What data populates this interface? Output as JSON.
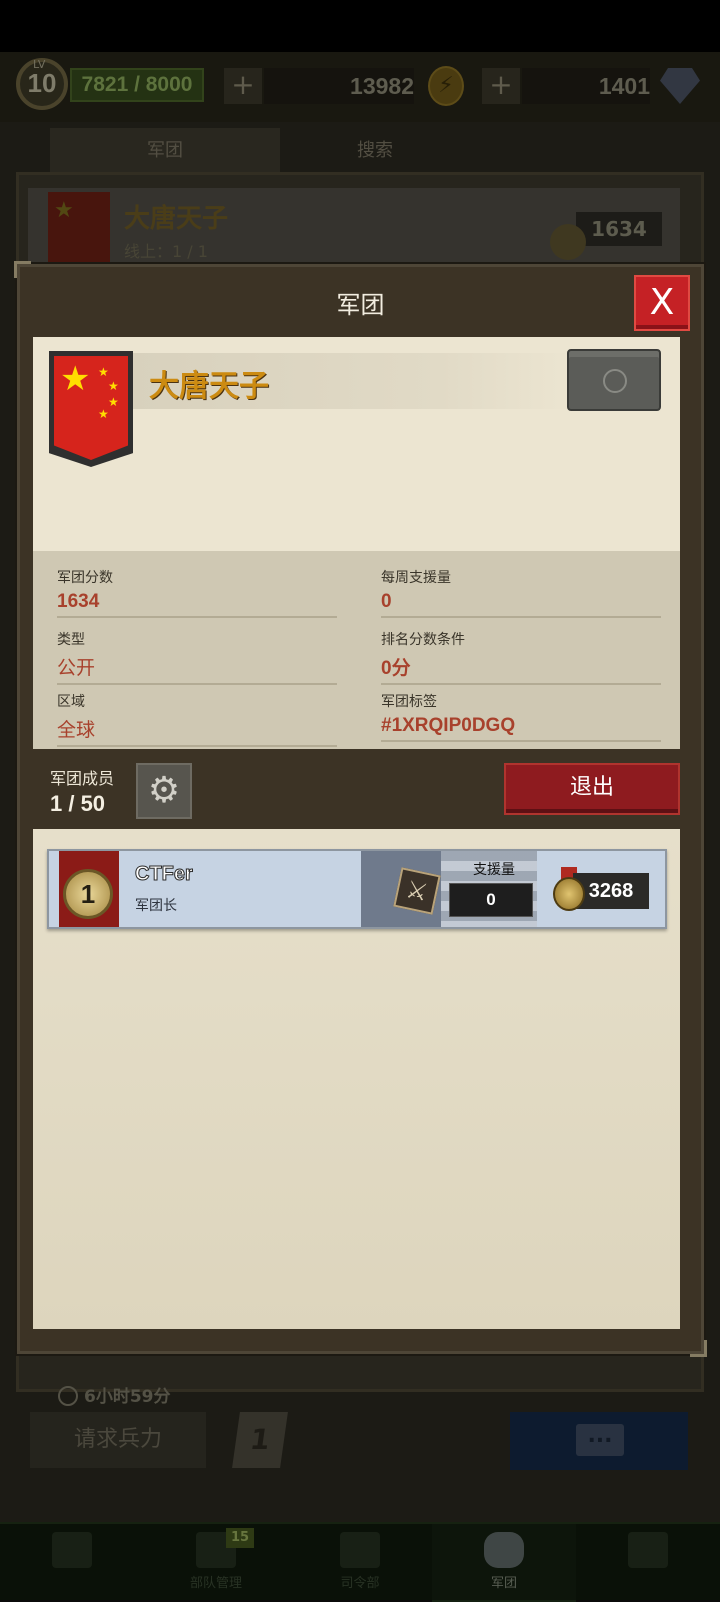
{
  "hud": {
    "level_tag": "LV",
    "level": "10",
    "xp": "7821 / 8000",
    "plus": "+",
    "gold": "13982",
    "gems": "1401"
  },
  "background_tabs": [
    "军团",
    "搜索"
  ],
  "background_guild": {
    "name": "大唐天子",
    "online": "线上：1 / 1",
    "score": "1634"
  },
  "modal": {
    "title": "军团",
    "close": "X",
    "guild_name": "大唐天子",
    "stats": [
      {
        "label": "军团分数",
        "value": "1634"
      },
      {
        "label": "每周支援量",
        "value": "0"
      },
      {
        "label": "类型",
        "value": "公开"
      },
      {
        "label": "排名分数条件",
        "value": "0分"
      },
      {
        "label": "区域",
        "value": "全球"
      },
      {
        "label": "军团标签",
        "value": "#1XRQIP0DGQ"
      }
    ],
    "members_label": "军团成员",
    "members_count": "1 / 50",
    "exit_label": "退出",
    "members": [
      {
        "rank": "1",
        "name": "CTFer",
        "role": "军团长",
        "support_label": "支援量",
        "support": "0",
        "score": "3268"
      }
    ]
  },
  "footer": {
    "timer": "6小时59分",
    "request_label": "请求兵力",
    "request_count": "1",
    "chat_icon": "..."
  },
  "bottom_nav": {
    "items": [
      "",
      "部队管理",
      "司令部",
      "军团",
      ""
    ],
    "badge": "15",
    "active": "军团"
  },
  "colors": {
    "accent_red": "#c52125",
    "guild_name_gold": "#cc8b12",
    "value_red": "#a8412c",
    "member_row": "#c6d3e3"
  }
}
